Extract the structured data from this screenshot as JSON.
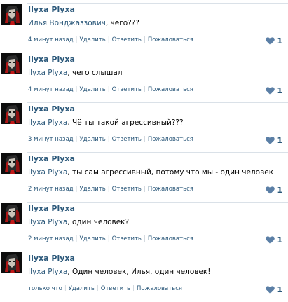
{
  "comments": [
    {
      "author": "Ilyxa Plyxa",
      "mention": "Илья Вонджаззович",
      "text": ", чего???",
      "time": "4 минут назад",
      "delete_label": "Удалить",
      "reply_label": "Ответить",
      "report_label": "Пожаловаться",
      "likes": "1",
      "avatar_icon": "dark-portrait-avatar-icon",
      "like_icon": "heart-icon"
    },
    {
      "author": "Ilyxa Plyxa",
      "mention": "Ilyxa Plyxa",
      "text": ", чего слышал",
      "time": "4 минут назад",
      "delete_label": "Удалить",
      "reply_label": "Ответить",
      "report_label": "Пожаловаться",
      "likes": "1",
      "avatar_icon": "dark-portrait-avatar-icon",
      "like_icon": "heart-icon"
    },
    {
      "author": "Ilyxa Plyxa",
      "mention": "Ilyxa Plyxa",
      "text": ", Чё ты такой агрессивный???",
      "time": "3 минут назад",
      "delete_label": "Удалить",
      "reply_label": "Ответить",
      "report_label": "Пожаловаться",
      "likes": "1",
      "avatar_icon": "dark-portrait-avatar-icon",
      "like_icon": "heart-icon"
    },
    {
      "author": "Ilyxa Plyxa",
      "mention": "Ilyxa Plyxa",
      "text": ", ты сам агрессивный, потому что мы - один человек",
      "time": "2 минут назад",
      "delete_label": "Удалить",
      "reply_label": "Ответить",
      "report_label": "Пожаловаться",
      "likes": "1",
      "avatar_icon": "dark-portrait-avatar-icon",
      "like_icon": "heart-icon"
    },
    {
      "author": "Ilyxa Plyxa",
      "mention": "Ilyxa Plyxa",
      "text": ", один человек?",
      "time": "2 минут назад",
      "delete_label": "Удалить",
      "reply_label": "Ответить",
      "report_label": "Пожаловаться",
      "likes": "1",
      "avatar_icon": "dark-portrait-avatar-icon",
      "like_icon": "heart-icon"
    },
    {
      "author": "Ilyxa Plyxa",
      "mention": "Ilyxa Plyxa",
      "text": ", Один человек, Илья, один человек!",
      "time": "только что",
      "delete_label": "Удалить",
      "reply_label": "Ответить",
      "report_label": "Пожаловаться",
      "likes": "1",
      "avatar_icon": "dark-portrait-avatar-icon",
      "like_icon": "heart-icon"
    }
  ],
  "colors": {
    "link": "#2b587a",
    "meta_text": "#777777",
    "separator": "#c5cdd4",
    "rule": "#dae1e8",
    "heart": "#5b7fa6"
  }
}
